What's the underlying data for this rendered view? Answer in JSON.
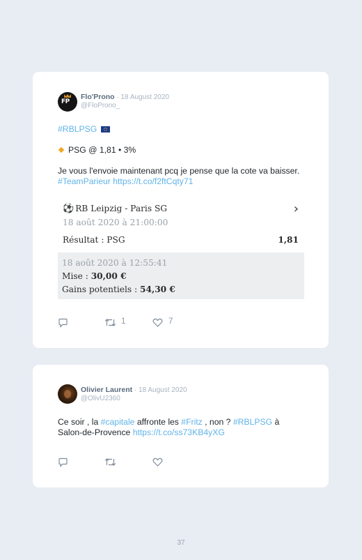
{
  "tweets": [
    {
      "author": "Flo'Prono",
      "date": "18 August 2020",
      "handle": "@FloProno_",
      "hashtag_line": "#RBLPSG",
      "pick_line": "PSG @ 1,81 • 3%",
      "body_text": "Je vous l'envoie maintenant pcq je pense que la cote va baisser.",
      "body_tag": "#TeamParieur",
      "body_link": "https://t.co/f2ftCqty71",
      "bet_slip": {
        "match": "RB Leipzig - Paris SG",
        "kickoff": "18 août 2020 à 21:00:00",
        "result_label": "Résultat : PSG",
        "odds": "1,81",
        "placed_at": "18 août 2020 à 12:55:41",
        "stake_label": "Mise :",
        "stake_value": "30,00 €",
        "gain_label": "Gains potentiels :",
        "gain_value": "54,30 €"
      },
      "retweets": "1",
      "likes": "7"
    },
    {
      "author": "Olivier Laurent",
      "date": "18 August 2020",
      "handle": "@OlivU2360",
      "text_1": "Ce soir , la",
      "tag_1": "#capitale",
      "text_2": "affronte les",
      "tag_2": "#Fritz",
      "text_3": ", non ?",
      "tag_3": "#RBLPSG",
      "text_4": "à",
      "text_5": "Salon-de-Provence",
      "link": "https://t.co/ss73KB4yXG"
    }
  ],
  "icons": [
    "reply-icon",
    "retweet-icon",
    "like-icon",
    "soccer-ball-icon",
    "chevron-right-icon",
    "eu-flag-icon",
    "orange-diamond-icon"
  ],
  "colors": {
    "link": "#5fb3e8",
    "background": "#e8ecf3",
    "card": "#ffffff"
  },
  "page_number": "37"
}
